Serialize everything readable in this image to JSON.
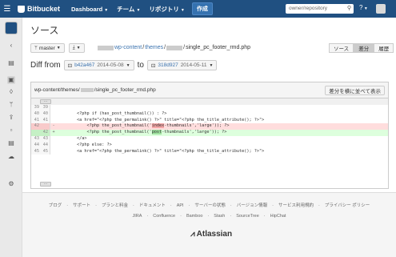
{
  "topbar": {
    "brand": "Bitbucket",
    "nav": [
      "Dashboard",
      "チーム",
      "リポジトリ"
    ],
    "create_label": "作成",
    "search_placeholder": "owner/repository",
    "help": "?",
    "colors": {
      "bar": "#205081",
      "create": "#3572b0"
    }
  },
  "page": {
    "title": "ソース",
    "branch": "master",
    "breadcrumb": [
      "wp-content",
      "themes",
      "single_pc_footer_rmd.php"
    ],
    "view_tabs": [
      "ソース",
      "差分",
      "履歴"
    ],
    "selected_tab": "差分",
    "diff_from_label": "Diff from",
    "to_label": "to",
    "from_commit": {
      "hash": "b42a467",
      "date": "2014-05-08"
    },
    "to_commit": {
      "hash": "318d927",
      "date": "2014-05-11"
    }
  },
  "diff": {
    "file_path_prefix": "wp-content/themes/",
    "file_path_suffix": "/single_pc_footer_rmd.php",
    "side_by_side_label": "差分を横に並べて表示",
    "lines": [
      {
        "n1": "39",
        "n2": "39",
        "sign": "",
        "type": "ctx",
        "code": ""
      },
      {
        "n1": "40",
        "n2": "40",
        "sign": "",
        "type": "ctx",
        "code": "        <?php if (has_post_thumbnail()) : ?>"
      },
      {
        "n1": "41",
        "n2": "41",
        "sign": "",
        "type": "ctx",
        "code": "        <a href=\"<?php the_permalink() ?>\" title=\"<?php the_title_attribute(); ?>\">"
      },
      {
        "n1": "42",
        "n2": "",
        "sign": "-",
        "type": "removed",
        "pre": "            <?php the_post_thumbnail('",
        "hl": "index",
        "post": "-thumbnails','large')); ?>"
      },
      {
        "n1": "",
        "n2": "42",
        "sign": "+",
        "type": "added",
        "pre": "            <?php the_post_thumbnail('",
        "hl": "post",
        "post": "-thumbnails','large')); ?>"
      },
      {
        "n1": "43",
        "n2": "43",
        "sign": "",
        "type": "ctx",
        "code": "        </a>"
      },
      {
        "n1": "44",
        "n2": "44",
        "sign": "",
        "type": "ctx",
        "code": "        <?php else: ?>"
      },
      {
        "n1": "45",
        "n2": "45",
        "sign": "",
        "type": "ctx",
        "code": "        <a href=\"<?php the_permalink() ?>\" title=\"<?php the_title_attribute(); ?>\">"
      }
    ]
  },
  "footer": {
    "links1": [
      "ブログ",
      "サポート",
      "プランと料金",
      "ドキュメント",
      "API",
      "サーバーの状態",
      "バージョン情報",
      "サービス利用規約",
      "プライバシー ポリシー"
    ],
    "links2": [
      "JIRA",
      "Confluence",
      "Bamboo",
      "Stash",
      "SourceTree",
      "HipChat"
    ],
    "brand": "Atlassian"
  }
}
